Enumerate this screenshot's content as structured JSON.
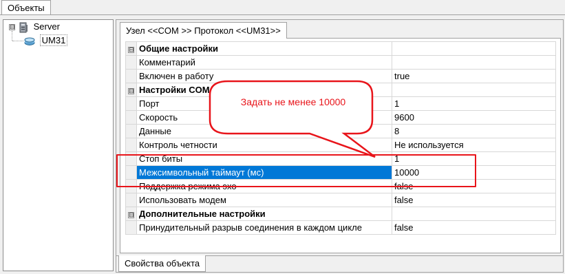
{
  "top_tab": {
    "label": "Объекты"
  },
  "tree": {
    "root": {
      "label": "Server",
      "expander": "⊟"
    },
    "child": {
      "label": "UM31"
    }
  },
  "inner_tab": {
    "label": "Узел <<COM  >> Протокол <<UM31>>"
  },
  "grid": {
    "rows": [
      {
        "kind": "category",
        "name": "Общие настройки",
        "value": "",
        "expander": "⊟"
      },
      {
        "kind": "prop",
        "name": "Комментарий",
        "value": ""
      },
      {
        "kind": "prop",
        "name": "Включен в работу",
        "value": "true"
      },
      {
        "kind": "category",
        "name": "Настройки COM",
        "value": "",
        "expander": "⊟"
      },
      {
        "kind": "prop",
        "name": "Порт",
        "value": "1"
      },
      {
        "kind": "prop",
        "name": "Скорость",
        "value": "9600"
      },
      {
        "kind": "prop",
        "name": "Данные",
        "value": "8"
      },
      {
        "kind": "prop",
        "name": "Контроль четности",
        "value": "Не используется"
      },
      {
        "kind": "prop",
        "name": "Стоп биты",
        "value": "1"
      },
      {
        "kind": "prop",
        "name": "Межсимвольный таймаут (мс)",
        "value": "10000",
        "selected": true
      },
      {
        "kind": "prop",
        "name": "Поддержка режима эхо",
        "value": "false"
      },
      {
        "kind": "prop",
        "name": "Использовать модем",
        "value": "false"
      },
      {
        "kind": "category",
        "name": "Дополнительные настройки",
        "value": "",
        "expander": "⊟"
      },
      {
        "kind": "prop",
        "name": "Принудительный разрыв соединения в каждом цикле",
        "value": "false"
      }
    ]
  },
  "callout": {
    "text": "Задать не менее 10000",
    "color": "#e8141a"
  },
  "selection_color": "#0078d7",
  "bottom_tab": {
    "label": "Свойства объекта"
  }
}
